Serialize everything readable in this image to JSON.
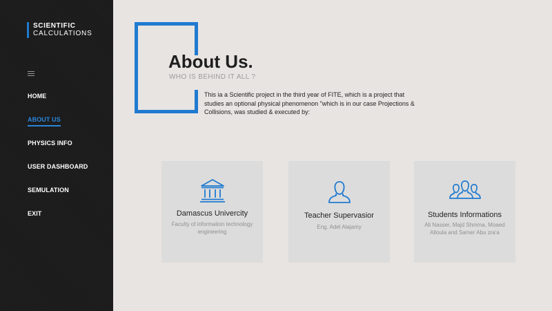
{
  "brand": {
    "line1": "SCIENTIFIC",
    "line2": "CALCULATIONS"
  },
  "nav": [
    {
      "label": "HOME",
      "active": false
    },
    {
      "label": "ABOUT US",
      "active": true
    },
    {
      "label": "PHYSICS INFO",
      "active": false
    },
    {
      "label": "USER DASHBOARD",
      "active": false
    },
    {
      "label": "SEMULATION",
      "active": false
    },
    {
      "label": "EXIT",
      "active": false
    }
  ],
  "about": {
    "title": "About Us.",
    "subtitle": "WHO IS BEHIND IT ALL ?",
    "intro": "This ia a Scientific project in the third year of FITE, which is a project that studies an optional physical phenomenon \"which is in our case Projections & Collisions, was studied & executed by:"
  },
  "cards": [
    {
      "icon": "university-icon",
      "title": "Damascus Univercity",
      "desc": "Faculty of information technology engineering"
    },
    {
      "icon": "user-icon",
      "title": "Teacher Supervasior",
      "desc": "Eng. Adel Alajamy"
    },
    {
      "icon": "users-group-icon",
      "title": "Students Informations",
      "desc": "Ali Nasser, Majd Shmma, Moaed Alloula and Samer Abu zra'a"
    }
  ],
  "colors": {
    "accent": "#1f7ad0",
    "sidebar": "#1b1b1b",
    "background": "#e8e4e2",
    "card": "#dcdcdc"
  }
}
